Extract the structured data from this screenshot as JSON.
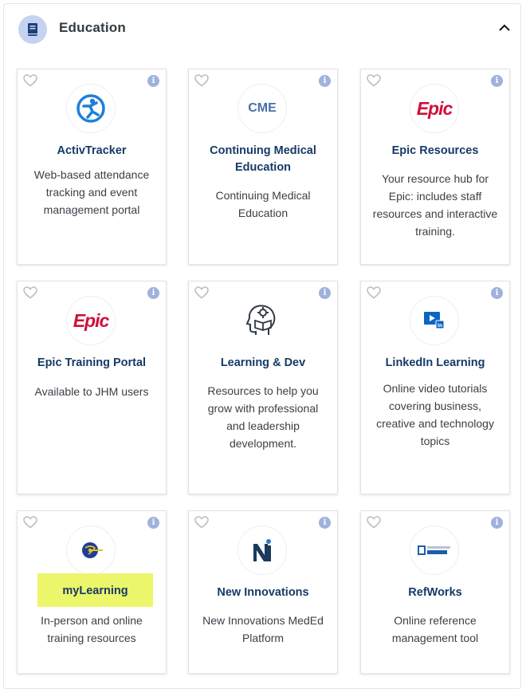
{
  "section": {
    "title": "Education",
    "icon": "book-icon",
    "state": "expanded"
  },
  "colors": {
    "title": "#163a66",
    "section_icon_bg": "#c5d3f3",
    "info_icon": "#9fb2dc",
    "epic_red": "#d0103a",
    "highlight": "#ecf66b"
  },
  "cards": [
    {
      "title": "ActivTracker",
      "description": "Web-based attendance tracking and event management portal",
      "icon": "activtracker-logo"
    },
    {
      "title": "Continuing Medical Education",
      "description": "Continuing Medical Education",
      "icon": "cme-logo",
      "logo_text": "CME"
    },
    {
      "title": "Epic Resources",
      "description": "Your resource hub for Epic: includes staff resources and interactive training.",
      "icon": "epic-logo",
      "logo_text": "Epic"
    },
    {
      "title": "Epic Training Portal",
      "description": "Available to JHM users",
      "icon": "epic-logo",
      "logo_text": "Epic"
    },
    {
      "title": "Learning & Dev",
      "description": "Resources to help you grow with professional and leadership development.",
      "icon": "head-gear-book-icon"
    },
    {
      "title": "LinkedIn Learning",
      "description": "Online video tutorials covering business, creative and technology topics",
      "icon": "linkedin-learning-icon"
    },
    {
      "title": "myLearning",
      "description": "In-person and online training resources",
      "icon": "mylearning-logo",
      "highlighted": true
    },
    {
      "title": "New Innovations",
      "description": "New Innovations MedEd Platform",
      "icon": "new-innovations-logo"
    },
    {
      "title": "RefWorks",
      "description": "Online reference management tool",
      "icon": "refworks-logo"
    }
  ]
}
